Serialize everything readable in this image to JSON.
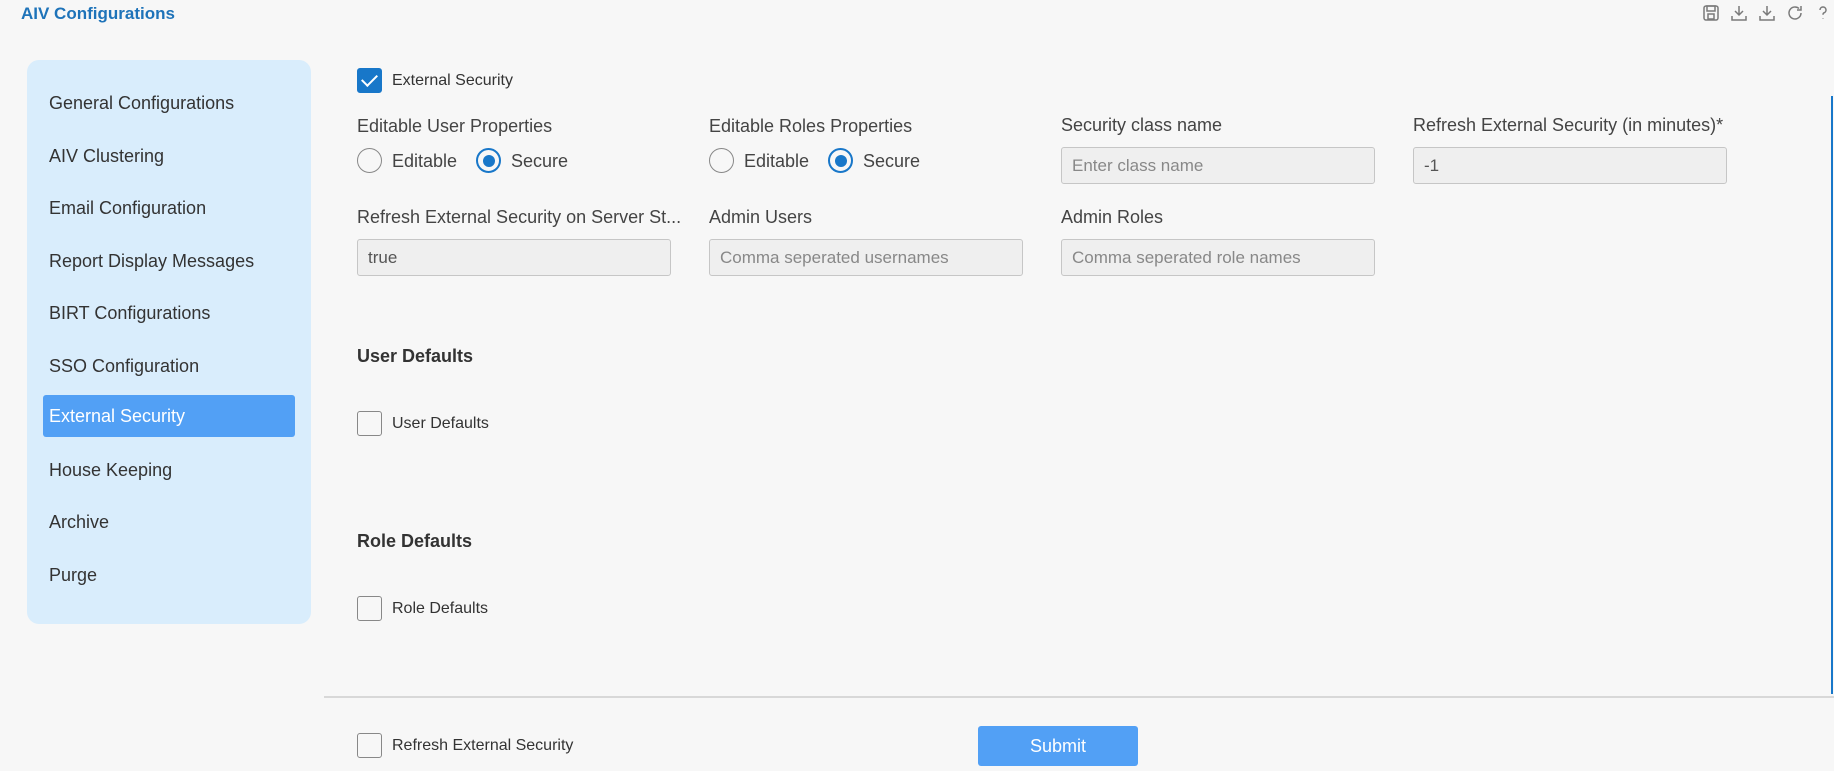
{
  "app": {
    "title": "AIV Configurations"
  },
  "toolbar": {
    "icons": [
      "save-icon",
      "download-icon",
      "download-alt-icon",
      "refresh-icon",
      "help-icon"
    ]
  },
  "sidebar": {
    "items": [
      {
        "label": "General Configurations"
      },
      {
        "label": "AIV Clustering"
      },
      {
        "label": "Email Configuration"
      },
      {
        "label": "Report Display Messages"
      },
      {
        "label": "BIRT Configurations"
      },
      {
        "label": "SSO Configuration"
      },
      {
        "label": "External Security",
        "active": true
      },
      {
        "label": "House Keeping"
      },
      {
        "label": "Archive"
      },
      {
        "label": "Purge"
      }
    ]
  },
  "form": {
    "external_security": {
      "label": "External Security",
      "checked": true
    },
    "editable_user_properties": {
      "label": "Editable User Properties",
      "options": [
        "Editable",
        "Secure"
      ],
      "selected": "Secure"
    },
    "editable_roles_properties": {
      "label": "Editable Roles Properties",
      "options": [
        "Editable",
        "Secure"
      ],
      "selected": "Secure"
    },
    "security_class_name": {
      "label": "Security class name",
      "value": "",
      "placeholder": "Enter class name"
    },
    "refresh_minutes": {
      "label": "Refresh External Security (in minutes)*",
      "value": "-1"
    },
    "refresh_on_start": {
      "label": "Refresh External Security on Server St...",
      "value": "true"
    },
    "admin_users": {
      "label": "Admin Users",
      "value": "",
      "placeholder": "Comma seperated usernames"
    },
    "admin_roles": {
      "label": "Admin Roles",
      "value": "",
      "placeholder": "Comma seperated role names"
    },
    "user_defaults": {
      "section_title": "User Defaults",
      "checkbox_label": "User Defaults",
      "checked": false
    },
    "role_defaults": {
      "section_title": "Role Defaults",
      "checkbox_label": "Role Defaults",
      "checked": false
    }
  },
  "footer": {
    "refresh_checkbox": {
      "label": "Refresh External Security",
      "checked": false
    },
    "submit_label": "Submit"
  },
  "colors": {
    "accent": "#1877c9",
    "active_item": "#52a0f5",
    "sidebar_bg": "#d9edfc",
    "title": "#1e73b9"
  }
}
